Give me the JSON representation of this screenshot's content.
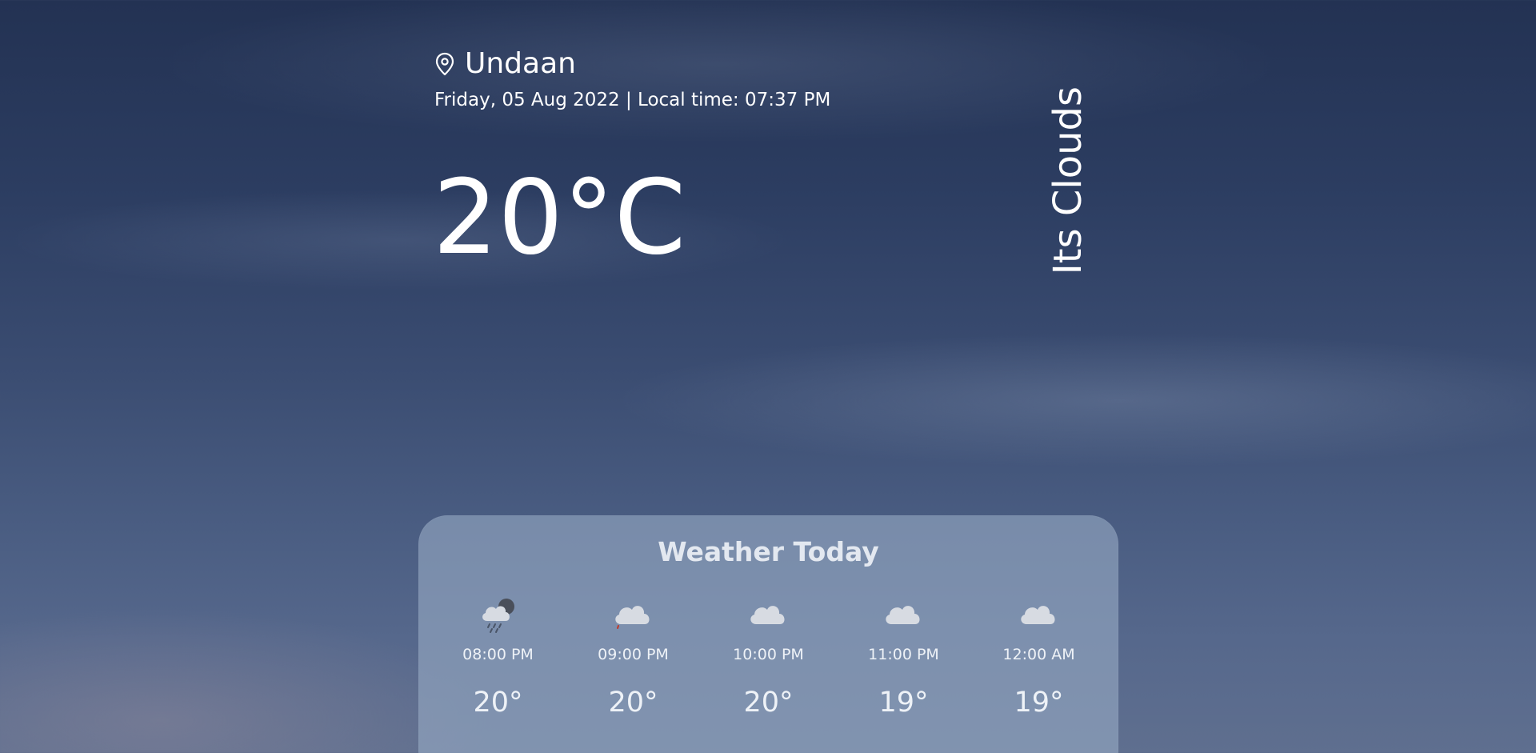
{
  "location": {
    "city": "Undaan",
    "datetime": "Friday, 05 Aug 2022 | Local time: 07:37 PM",
    "icon": "map-pin-icon"
  },
  "current": {
    "temperature": "20°C",
    "condition": "Its Clouds"
  },
  "forecast": {
    "title": "Weather Today",
    "hours": [
      {
        "time": "08:00 PM",
        "temp": "20°",
        "icon": "rain-cloud-night-icon"
      },
      {
        "time": "09:00 PM",
        "temp": "20°",
        "icon": "cloud-icon"
      },
      {
        "time": "10:00 PM",
        "temp": "20°",
        "icon": "cloud-icon"
      },
      {
        "time": "11:00 PM",
        "temp": "19°",
        "icon": "cloud-icon"
      },
      {
        "time": "12:00 AM",
        "temp": "19°",
        "icon": "cloud-icon"
      }
    ]
  },
  "colors": {
    "sky_top": "#233253",
    "sky_bottom": "#5f6f8f",
    "card": "#96aac4",
    "text": "#ffffff"
  }
}
